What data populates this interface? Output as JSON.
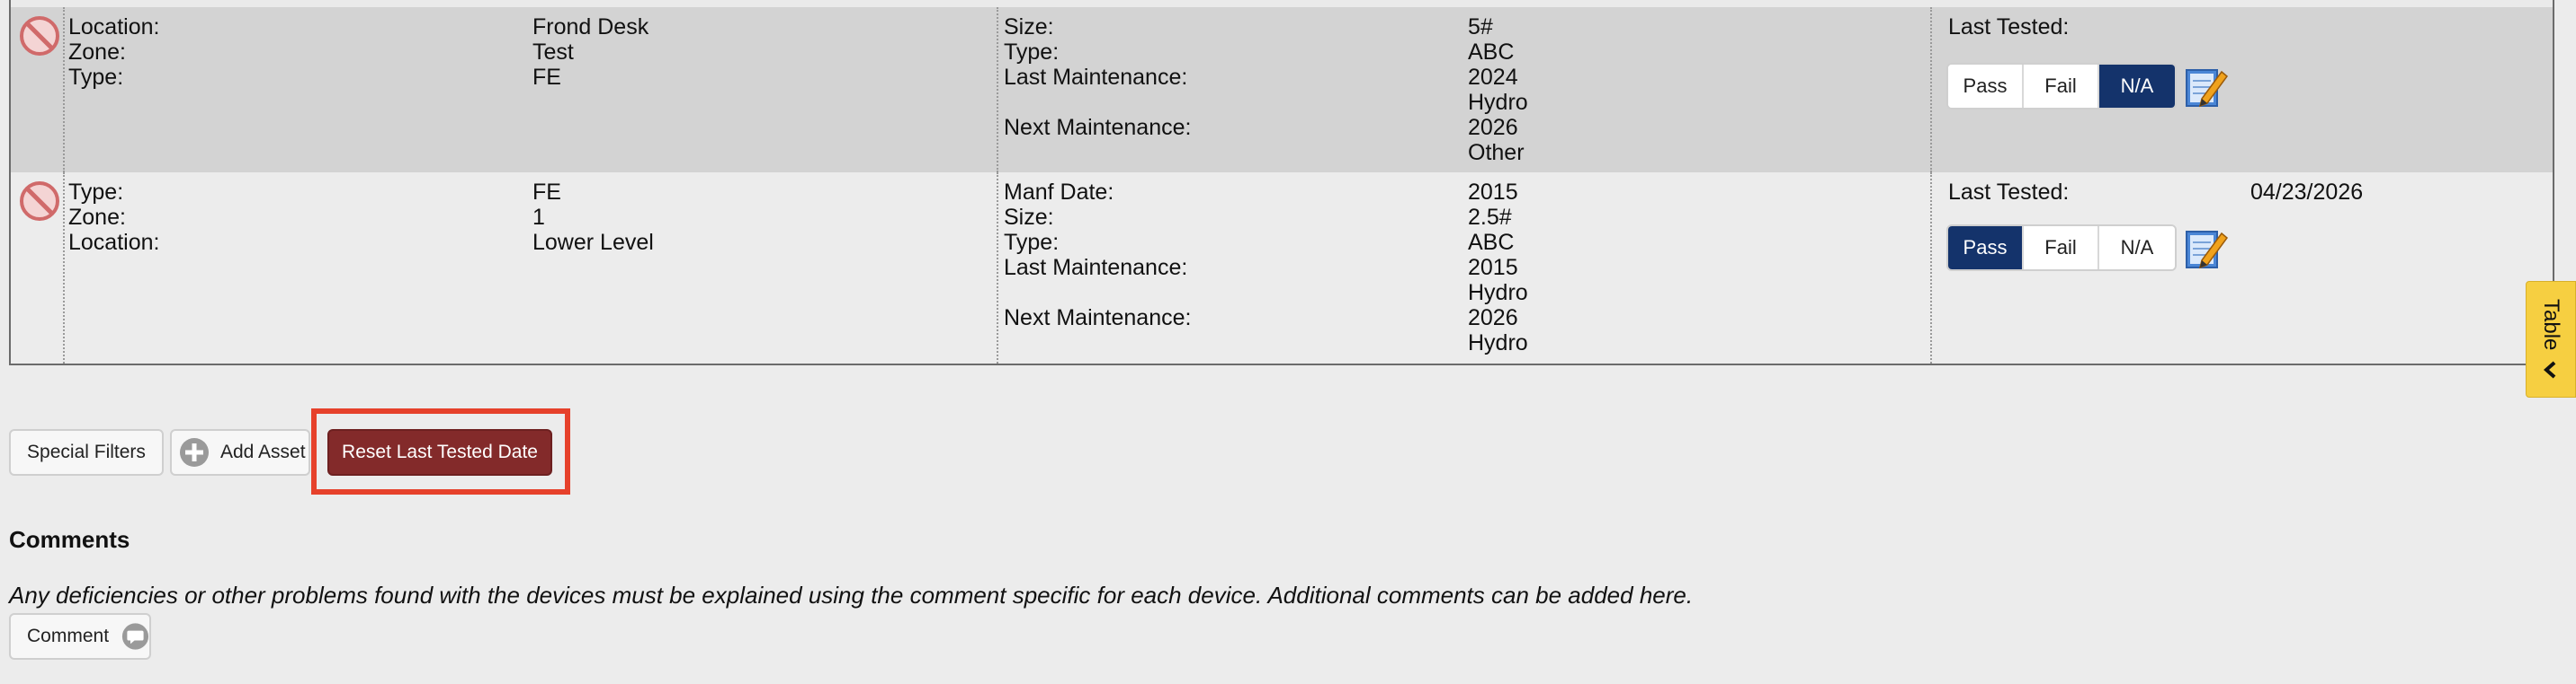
{
  "assets": [
    {
      "info": [
        {
          "label": "Location:",
          "value": "Frond Desk"
        },
        {
          "label": "Zone:",
          "value": "Test"
        },
        {
          "label": "Type:",
          "value": "FE"
        }
      ],
      "details": [
        {
          "label": "Size:",
          "value": "5#"
        },
        {
          "label": "Type:",
          "value": "ABC"
        },
        {
          "label": "Last Maintenance:",
          "value": "2024"
        },
        {
          "label": "",
          "value": "Hydro"
        },
        {
          "label": "Next Maintenance:",
          "value": "2026"
        },
        {
          "label": "",
          "value": "Other"
        }
      ],
      "last_tested_label": "Last Tested:",
      "last_tested_date": "",
      "status_options": [
        "Pass",
        "Fail",
        "N/A"
      ],
      "selected_status": "N/A"
    },
    {
      "info": [
        {
          "label": "Type:",
          "value": "FE"
        },
        {
          "label": "Zone:",
          "value": "1"
        },
        {
          "label": "Location:",
          "value": "Lower Level"
        }
      ],
      "details": [
        {
          "label": "Manf Date:",
          "value": "2015"
        },
        {
          "label": "Size:",
          "value": "2.5#"
        },
        {
          "label": "Type:",
          "value": "ABC"
        },
        {
          "label": "Last Maintenance:",
          "value": "2015"
        },
        {
          "label": "",
          "value": "Hydro"
        },
        {
          "label": "Next Maintenance:",
          "value": "2026"
        },
        {
          "label": "",
          "value": "Hydro"
        }
      ],
      "last_tested_label": "Last Tested:",
      "last_tested_date": "04/23/2026",
      "status_options": [
        "Pass",
        "Fail",
        "N/A"
      ],
      "selected_status": "Pass"
    }
  ],
  "side_tab": {
    "label": "Table"
  },
  "toolbar": {
    "special_filters": "Special Filters",
    "add_asset": "Add Asset",
    "reset_last_tested": "Reset Last Tested Date"
  },
  "comments": {
    "title": "Comments",
    "note": "Any deficiencies or other problems found with the devices must be explained using the comment specific for each device. Additional comments can be added here.",
    "button": "Comment"
  },
  "colors": {
    "active_segment": "#14336b",
    "reset_button": "#832a2a",
    "highlight_border": "#e6412b",
    "side_tab": "#f6cf41"
  },
  "icons": {
    "delete": "delete-prohibited-icon",
    "edit": "edit-notepad-icon",
    "add": "plus-circle-icon",
    "comment": "speech-bubble-icon",
    "tab": "chevron-left-icon"
  }
}
